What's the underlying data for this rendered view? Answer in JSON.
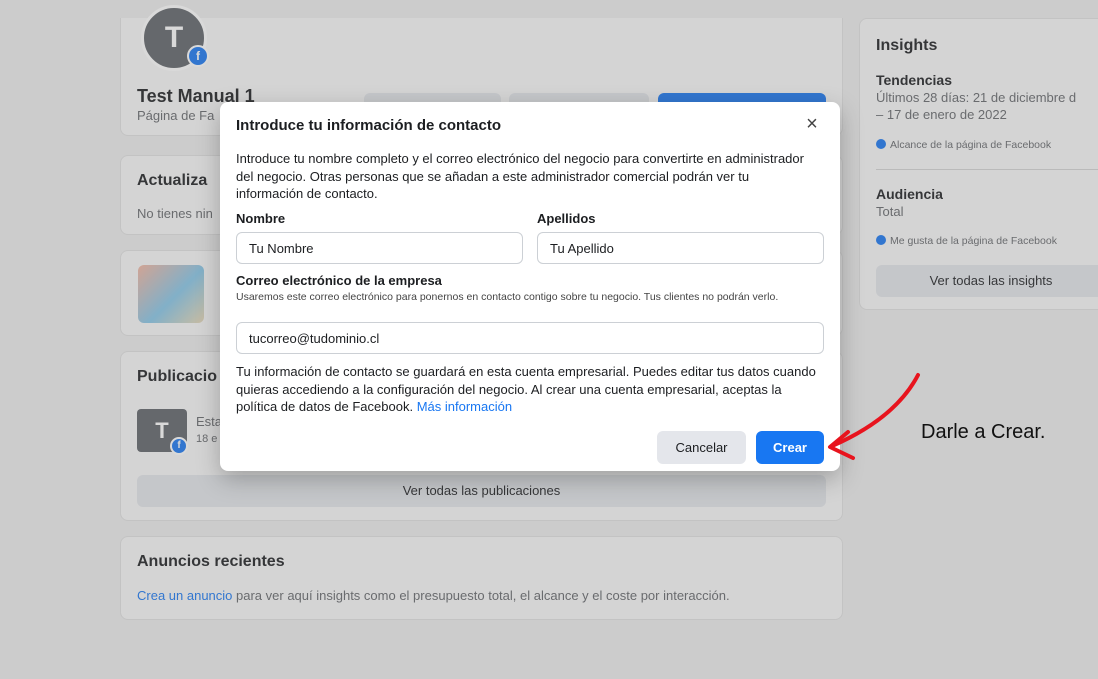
{
  "profile": {
    "avatar_letter": "T",
    "page_name": "Test Manual 1",
    "page_type_partial": "Página de Fa"
  },
  "updates": {
    "title_partial": "Actualiza",
    "desc_partial": "No tienes nin"
  },
  "posts": {
    "title_partial": "Publicacio",
    "post_title_partial": "Esta",
    "post_date_partial": "18 e",
    "avatar_letter": "T",
    "see_all": "Ver todas las publicaciones"
  },
  "ads": {
    "title": "Anuncios recientes",
    "link": "Crea un anuncio",
    "desc": " para ver aquí insights como el presupuesto total, el alcance y el coste por interacción."
  },
  "insights": {
    "title": "Insights",
    "trends_title": "Tendencias",
    "trends_line1": "Últimos 28 días: 21 de diciembre d",
    "trends_line2": "– 17 de enero de 2022",
    "reach": "Alcance de la página de Facebook",
    "audience_title": "Audiencia",
    "audience_sub": "Total",
    "likes": "Me gusta de la página de Facebook",
    "see_all": "Ver todas las insights"
  },
  "modal": {
    "title": "Introduce tu información de contacto",
    "close_icon": "×",
    "description": "Introduce tu nombre completo y el correo electrónico del negocio para convertirte en administrador del negocio. Otras personas que se añadan a este administrador comercial podrán ver tu información de contacto.",
    "first_name_label": "Nombre",
    "first_name_value": "Tu Nombre",
    "last_name_label": "Apellidos",
    "last_name_value": "Tu Apellido",
    "email_label": "Correo electrónico de la empresa",
    "email_help": "Usaremos este correo electrónico para ponernos en contacto contigo sobre tu negocio. Tus clientes no podrán verlo.",
    "email_value": "tucorreo@tudominio.cl",
    "footer_text": "Tu información de contacto se guardará en esta cuenta empresarial. Puedes editar tus datos cuando quieras accediendo a la configuración del negocio. Al crear una cuenta empresarial, aceptas la política de datos de Facebook. ",
    "more_info": "Más información",
    "cancel": "Cancelar",
    "create": "Crear"
  },
  "annotation": {
    "text": "Darle a Crear.",
    "arrow_color": "#e8141e"
  },
  "colors": {
    "accent": "#1877f2",
    "background": "#ededed"
  }
}
